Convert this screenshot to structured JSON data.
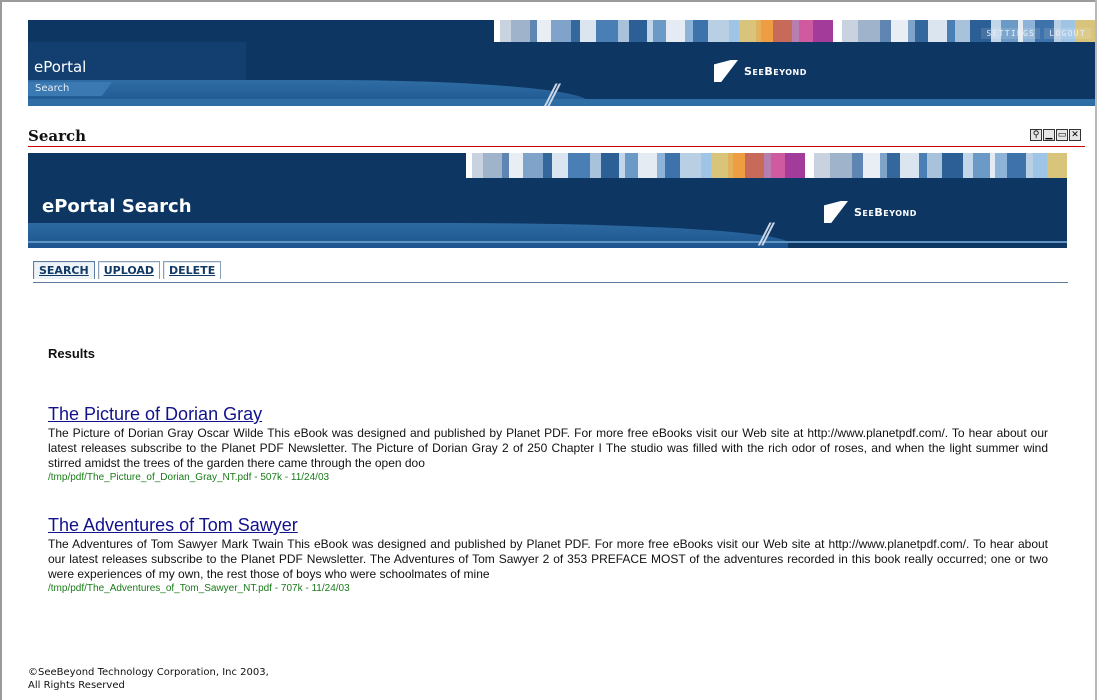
{
  "header": {
    "app_title": "ePortal",
    "tab_label": "Search",
    "nav": [
      "SETTINGS",
      "LOGOUT"
    ],
    "logo_text": "SeeBeyond"
  },
  "portlet": {
    "title": "Search",
    "icons": [
      "magnify-icon",
      "minimize-icon",
      "maximize-icon",
      "close-icon"
    ]
  },
  "banner": {
    "title": "ePortal Search",
    "logo_text": "SeeBeyond"
  },
  "tabs": [
    {
      "label": "SEARCH",
      "active": true
    },
    {
      "label": "UPLOAD",
      "active": false
    },
    {
      "label": "DELETE",
      "active": false
    }
  ],
  "results_label": "Results",
  "results": [
    {
      "title": "The Picture of Dorian Gray",
      "snippet": "The Picture of Dorian Gray Oscar Wilde This eBook was designed and published by Planet PDF. For more free eBooks visit our Web site at http://www.planetpdf.com/. To hear about our latest releases subscribe to the Planet PDF Newsletter. The Picture of Dorian Gray 2 of 250 Chapter I The studio was filled with the rich odor of roses, and when the light summer wind stirred amidst the trees of the garden there came through the open doo",
      "meta": "/tmp/pdf/The_Picture_of_Dorian_Gray_NT.pdf - 507k - 11/24/03"
    },
    {
      "title": "The Adventures of Tom Sawyer",
      "snippet": "The Adventures of Tom Sawyer Mark Twain This eBook was designed and published by Planet PDF. For more free eBooks visit our Web site at http://www.planetpdf.com/. To hear about our latest releases subscribe to the Planet PDF Newsletter. The Adventures of Tom Sawyer 2 of 353 PREFACE MOST of the adventures recorded in this book really occurred; one or two were experiences of my own, the rest those of boys who were schoolmates of mine",
      "meta": "/tmp/pdf/The_Adventures_of_Tom_Sawyer_NT.pdf - 707k - 11/24/03"
    }
  ],
  "footer": {
    "line1": "©SeeBeyond Technology Corporation, Inc 2003,",
    "line2": "All Rights Reserved"
  },
  "colors": {
    "header_bg": "#0e3663",
    "link": "#12128c",
    "meta": "#1a7a1a",
    "portlet_rule": "#cc0000"
  }
}
